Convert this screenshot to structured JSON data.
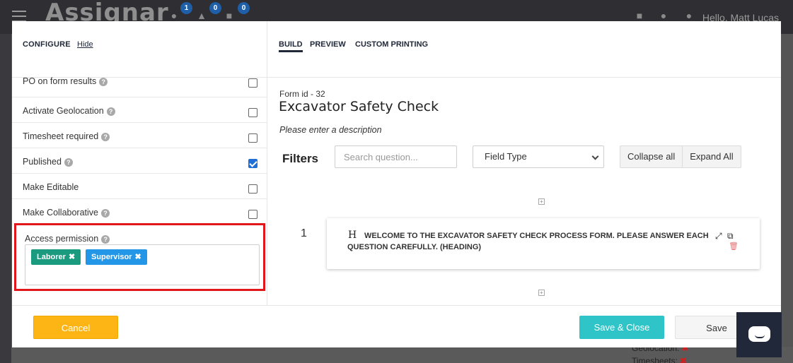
{
  "app": {
    "brand": "Assignar",
    "badges": [
      "1",
      "0",
      "0"
    ],
    "greeting": "Hello, Matt Lucas",
    "bg_geolocation": "Geolocation:",
    "bg_timesheets": "Timesheets:"
  },
  "configure": {
    "title": "CONFIGURE",
    "hide_link": "Hide",
    "settings": [
      {
        "label": "PO on form results",
        "help": true,
        "checked": false
      },
      {
        "label": "Activate Geolocation",
        "help": true,
        "checked": false
      },
      {
        "label": "Timesheet required",
        "help": true,
        "checked": false
      },
      {
        "label": "Published",
        "help": true,
        "checked": true
      },
      {
        "label": "Make Editable",
        "help": false,
        "checked": false
      },
      {
        "label": "Make Collaborative",
        "help": true,
        "checked": false
      }
    ],
    "access_permission": {
      "label": "Access permission",
      "tags": [
        {
          "label": "Laborer",
          "color": "#1a9a7f"
        },
        {
          "label": "Supervisor",
          "color": "#2496e8"
        }
      ]
    }
  },
  "tabs": [
    "BUILD",
    "PREVIEW",
    "CUSTOM PRINTING"
  ],
  "form": {
    "id_label": "Form id - 32",
    "title": "Excavator Safety Check",
    "description": "Please enter a description"
  },
  "filters": {
    "label": "Filters",
    "search_placeholder": "Search question...",
    "field_type": "Field Type",
    "collapse": "Collapse all",
    "expand": "Expand All"
  },
  "question": {
    "number": "1",
    "type_glyph": "H",
    "text": "WELCOME TO THE EXCAVATOR SAFETY CHECK PROCESS FORM. PLEASE ANSWER EACH QUESTION CAREFULLY.   (HEADING)"
  },
  "footer": {
    "cancel": "Cancel",
    "save_close": "Save & Close",
    "save": "Save"
  },
  "colors": {
    "accent_yellow": "#fdb515",
    "accent_teal": "#2fc4c8",
    "highlight_red": "#e0161b",
    "navy": "#20283a"
  }
}
